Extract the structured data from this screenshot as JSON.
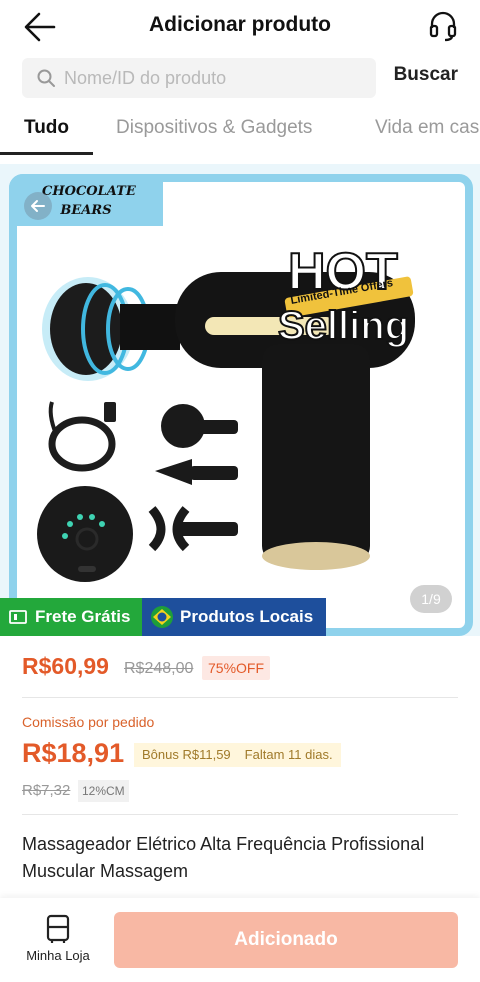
{
  "header": {
    "title": "Adicionar produto",
    "back_icon": "arrow-left-icon",
    "support_icon": "headset-icon"
  },
  "search": {
    "placeholder": "Nome/ID do produto",
    "value": "",
    "button_label": "Buscar"
  },
  "tabs": [
    {
      "label": "Tudo",
      "active": true
    },
    {
      "label": "Dispositivos & Gadgets",
      "active": false
    },
    {
      "label": "Vida em casa",
      "active": false
    }
  ],
  "product_image": {
    "brand": "CHOCOLATE BEARS",
    "banner_hot": "HOT",
    "banner_offer": "Limited-Time Offers",
    "banner_selling": "Selling",
    "pager": "1/9"
  },
  "badges": {
    "free_shipping": "Frete Grátis",
    "local_products": "Produtos Locais"
  },
  "pricing": {
    "price": "R$60,99",
    "original_price": "R$248,00",
    "discount": "75%OFF",
    "commission_label": "Comissão por pedido",
    "commission_value": "R$18,91",
    "bonus": "Bônus R$11,59",
    "bonus_deadline": "Faltam 11 dias.",
    "old_commission": "R$7,32",
    "commission_rate": "12%CM"
  },
  "product_name": "Massageador Elétrico Alta Frequência Profissional Muscular Massagem",
  "bottom_bar": {
    "store_label": "Minha Loja",
    "add_button": "Adicionado"
  },
  "colors": {
    "accent": "#e35a29",
    "free_badge": "#23a83b",
    "local_badge": "#1e4f9c",
    "add_button": "#f8b8a4",
    "frame": "#8fd2ec"
  }
}
